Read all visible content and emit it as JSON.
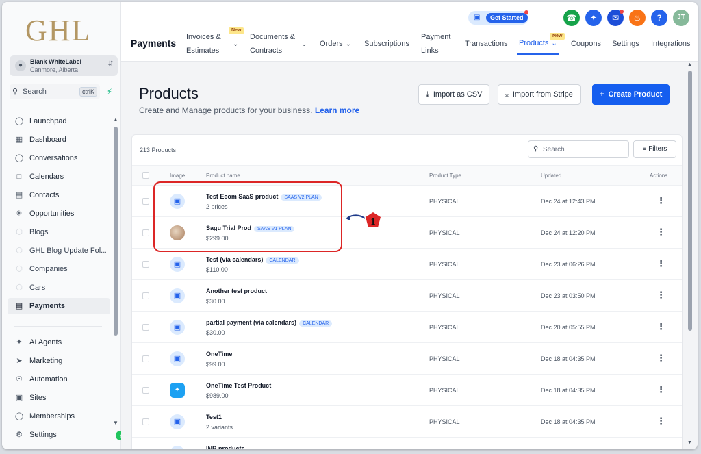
{
  "sidebar": {
    "logo": "GHL",
    "location": {
      "name": "Blank WhiteLabel",
      "address": "Canmore, Alberta"
    },
    "search": {
      "placeholder": "Search",
      "shortcut": "ctrlK"
    },
    "items": [
      {
        "label": "Launchpad",
        "icon": "rocket-icon"
      },
      {
        "label": "Dashboard",
        "icon": "dashboard-icon"
      },
      {
        "label": "Conversations",
        "icon": "chat-icon"
      },
      {
        "label": "Calendars",
        "icon": "calendar-icon"
      },
      {
        "label": "Contacts",
        "icon": "contacts-icon"
      },
      {
        "label": "Opportunities",
        "icon": "opportunities-icon"
      },
      {
        "label": "Blogs",
        "icon": "cube-icon"
      },
      {
        "label": "GHL Blog Update Fol...",
        "icon": "cube-icon"
      },
      {
        "label": "Companies",
        "icon": "cube-icon"
      },
      {
        "label": "Cars",
        "icon": "cube-icon"
      },
      {
        "label": "Payments",
        "icon": "receipt-icon",
        "active": true
      },
      {
        "label": "AI Agents",
        "icon": "sparkle-icon"
      },
      {
        "label": "Marketing",
        "icon": "send-icon"
      },
      {
        "label": "Automation",
        "icon": "automation-icon"
      },
      {
        "label": "Sites",
        "icon": "sites-icon"
      },
      {
        "label": "Memberships",
        "icon": "membership-icon"
      },
      {
        "label": "Settings",
        "icon": "gear-icon"
      }
    ]
  },
  "header": {
    "get_started": "Get Started",
    "avatar_initials": "JT",
    "help": "?",
    "section_title": "Payments",
    "tabs": [
      {
        "line1": "Invoices &",
        "line2": "Estimates",
        "badge": "New",
        "chevron": true
      },
      {
        "line1": "Documents &",
        "line2": "Contracts",
        "chevron": true
      },
      {
        "line1": "Orders",
        "chevron": true
      },
      {
        "line1": "Subscriptions"
      },
      {
        "line1": "Payment",
        "line2": "Links"
      },
      {
        "line1": "Transactions"
      },
      {
        "line1": "Products",
        "badge": "New",
        "chevron": true,
        "active": true
      },
      {
        "line1": "Coupons"
      },
      {
        "line1": "Settings"
      },
      {
        "line1": "Integrations"
      }
    ]
  },
  "main": {
    "title": "Products",
    "subtitle": "Create and Manage products for your business.",
    "learn_more": "Learn more",
    "buttons": {
      "import_csv": "Import as CSV",
      "import_stripe": "Import from Stripe",
      "create": "Create Product"
    },
    "count": "213 Products",
    "search_placeholder": "Search",
    "filters": "Filters",
    "columns": {
      "image": "Image",
      "name": "Product name",
      "type": "Product Type",
      "updated": "Updated",
      "actions": "Actions"
    },
    "rows": [
      {
        "name": "Test Ecom SaaS product",
        "tag": "SAAS V2 PLAN",
        "price": "2 prices",
        "type": "PHYSICAL",
        "updated": "Dec 24 at 12:43 PM",
        "image": "image-placeholder-icon"
      },
      {
        "name": "Sagu Trial Prod",
        "tag": "SAAS V1 PLAN",
        "price": "$299.00",
        "type": "PHYSICAL",
        "updated": "Dec 24 at 12:20 PM",
        "image": "product-photo"
      },
      {
        "name": "Test (via calendars)",
        "tag": "CALENDAR",
        "price": "$110.00",
        "type": "PHYSICAL",
        "updated": "Dec 23 at 06:26 PM",
        "image": "image-placeholder-icon"
      },
      {
        "name": "Another test product",
        "tag": "",
        "price": "$30.00",
        "type": "PHYSICAL",
        "updated": "Dec 23 at 03:50 PM",
        "image": "image-placeholder-icon"
      },
      {
        "name": "partial payment (via calendars)",
        "tag": "CALENDAR",
        "price": "$30.00",
        "type": "PHYSICAL",
        "updated": "Dec 20 at 05:55 PM",
        "image": "image-placeholder-icon"
      },
      {
        "name": "OneTime",
        "tag": "",
        "price": "$99.00",
        "type": "PHYSICAL",
        "updated": "Dec 18 at 04:35 PM",
        "image": "image-placeholder-icon"
      },
      {
        "name": "OneTime Test Product",
        "tag": "",
        "price": "$989.00",
        "type": "PHYSICAL",
        "updated": "Dec 18 at 04:35 PM",
        "image": "bird-logo"
      },
      {
        "name": "Test1",
        "tag": "",
        "price": "2 variants",
        "type": "PHYSICAL",
        "updated": "Dec 18 at 04:35 PM",
        "image": "image-placeholder-icon"
      },
      {
        "name": "INR products",
        "tag": "",
        "price": "",
        "type": "",
        "updated": "",
        "image": "image-placeholder-icon"
      }
    ]
  },
  "annotation": {
    "number": "1",
    "color": "#dc2626"
  },
  "colors": {
    "primary": "#155eef",
    "logo": "#b39764",
    "accent_green": "#10b981"
  }
}
